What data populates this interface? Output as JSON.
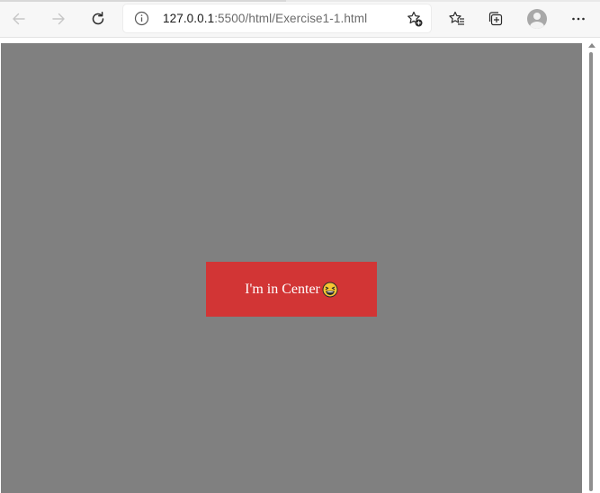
{
  "browser": {
    "address_bar": {
      "host": "127.0.0.1",
      "path": ":5500/html/Exercise1-1.html"
    },
    "icons": {
      "back": "arrow-left-icon",
      "forward": "arrow-right-icon",
      "reload": "reload-icon",
      "info": "info-icon",
      "add_favorite": "star-add-icon",
      "favorites": "favorites-list-icon",
      "collections": "collections-icon",
      "profile": "profile-avatar-icon",
      "more": "ellipsis-icon"
    }
  },
  "page": {
    "background_color": "#808080",
    "box_color": "#d23535",
    "box_text": "I'm in Center",
    "box_emoji": "grinning-squinting-face-icon"
  }
}
